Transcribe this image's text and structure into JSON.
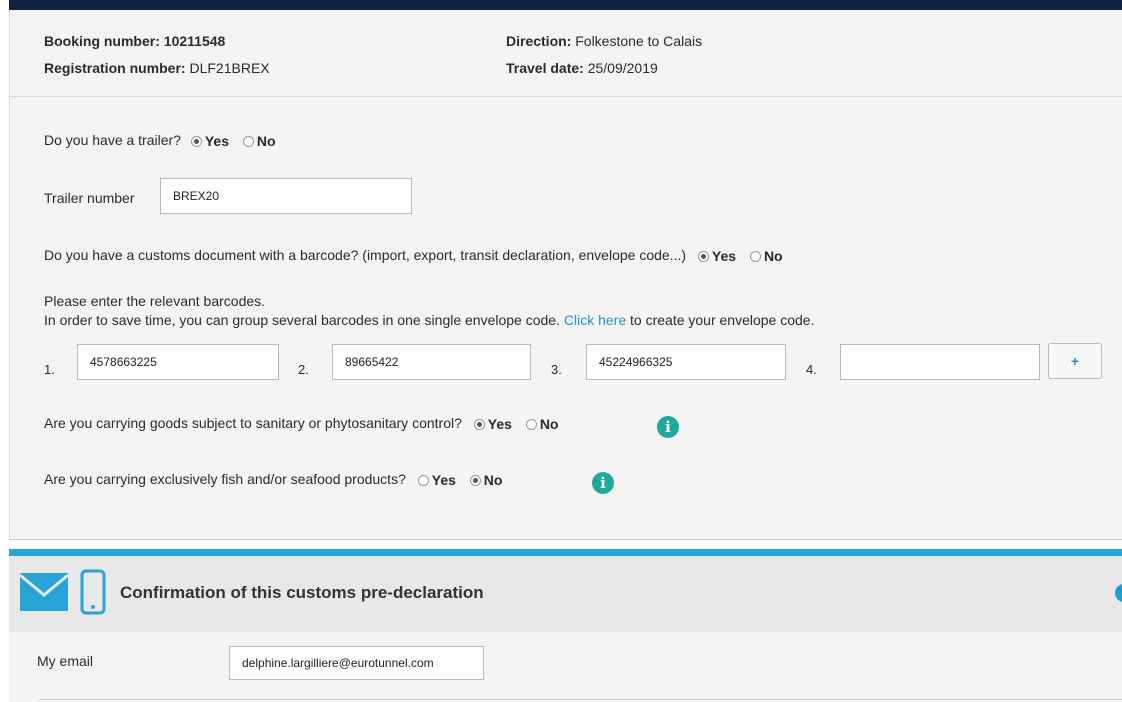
{
  "booking": {
    "booking_label": "Booking number:",
    "booking_value": "10211548",
    "registration_label": "Registration number:",
    "registration_value": "DLF21BREX",
    "direction_label": "Direction:",
    "direction_value": "Folkestone to Calais",
    "date_label": "Travel date:",
    "date_value": "25/09/2019"
  },
  "trailer_question": {
    "text": "Do you have a trailer?",
    "yes": "Yes",
    "no": "No",
    "selected": "Yes"
  },
  "trailer_number": {
    "label": "Trailer number",
    "value": "BREX20"
  },
  "customs_question": {
    "text": "Do you have a customs document with a barcode? (import, export, transit declaration, envelope code...)",
    "yes": "Yes",
    "no": "No",
    "selected": "Yes"
  },
  "barcodes": {
    "intro_line1": "Please enter the relevant barcodes.",
    "intro_line2_before": "In order to save time, you can group several barcodes in one single envelope code.",
    "link_text": "Click here",
    "intro_line2_after": "to create your envelope code.",
    "items": [
      {
        "num": "1.",
        "value": "4578663225"
      },
      {
        "num": "2.",
        "value": "89665422"
      },
      {
        "num": "3.",
        "value": "45224966325"
      },
      {
        "num": "4.",
        "value": ""
      }
    ],
    "add_label": "+"
  },
  "sanitary_question": {
    "text": "Are you carrying goods subject to sanitary or phytosanitary control?",
    "yes": "Yes",
    "no": "No",
    "selected": "Yes"
  },
  "fish_question": {
    "text": "Are you carrying exclusively fish and/or seafood products?",
    "yes": "Yes",
    "no": "No",
    "selected": "No"
  },
  "info_glyph": "i",
  "confirmation": {
    "title": "Confirmation of this customs pre-declaration",
    "email_label": "My email",
    "email_value": "delphine.largilliere@eurotunnel.com"
  },
  "colors": {
    "header_navy": "#0f2147",
    "accent_blue": "#27a3d7",
    "info_teal": "#1fa99a",
    "link_blue": "#2a8fd1"
  },
  "icons": [
    "envelope-icon",
    "mobile-phone-icon",
    "info-icon",
    "collapse-toggle-icon"
  ]
}
